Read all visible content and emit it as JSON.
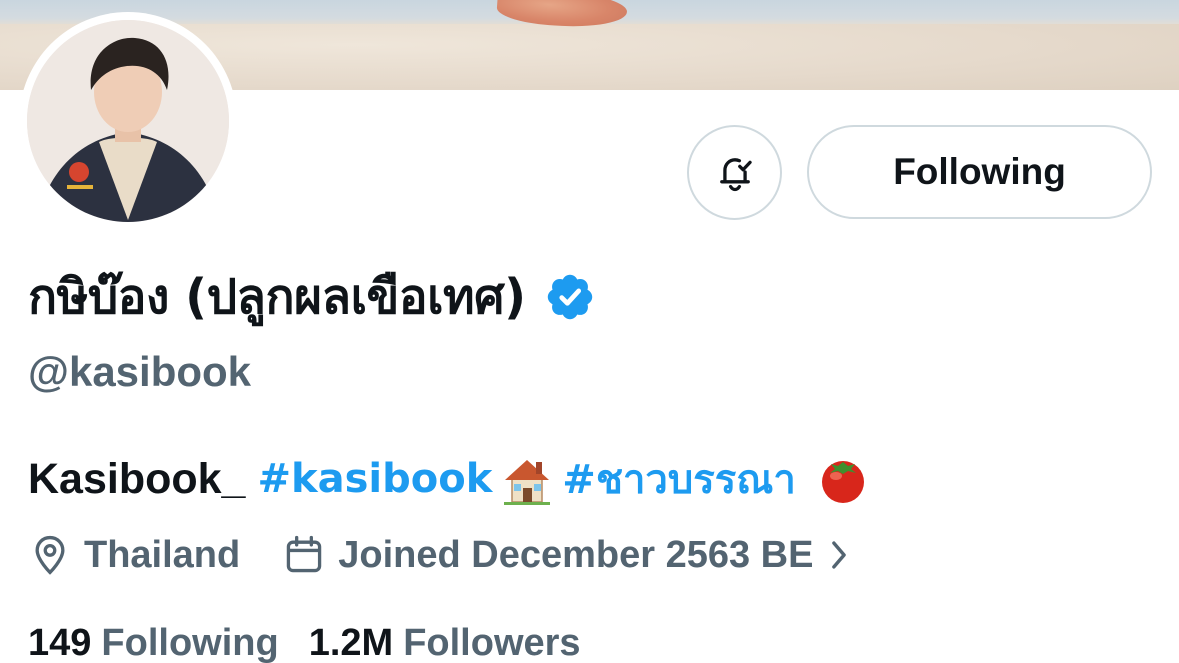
{
  "profile": {
    "display_name": "กษิบ๊อง (ปลูกผลเขือเทศ)",
    "handle": "@kasibook",
    "bio": {
      "text": "Kasibook_",
      "hashtag1": "#kasibook",
      "emoji1": "house-emoji",
      "hashtag2": "#ชาวบรรณา",
      "emoji2": "tomato-emoji"
    },
    "location": "Thailand",
    "joined": "Joined December 2563 BE",
    "stats": {
      "following_count": "149",
      "following_label": "Following",
      "followers_count": "1.2M",
      "followers_label": "Followers"
    }
  },
  "actions": {
    "notify_icon": "bell-check-icon",
    "following_label": "Following"
  },
  "colors": {
    "accent": "#1d9bf0",
    "text_primary": "#0f1419",
    "text_secondary": "#536471",
    "border": "#cfd9de"
  }
}
